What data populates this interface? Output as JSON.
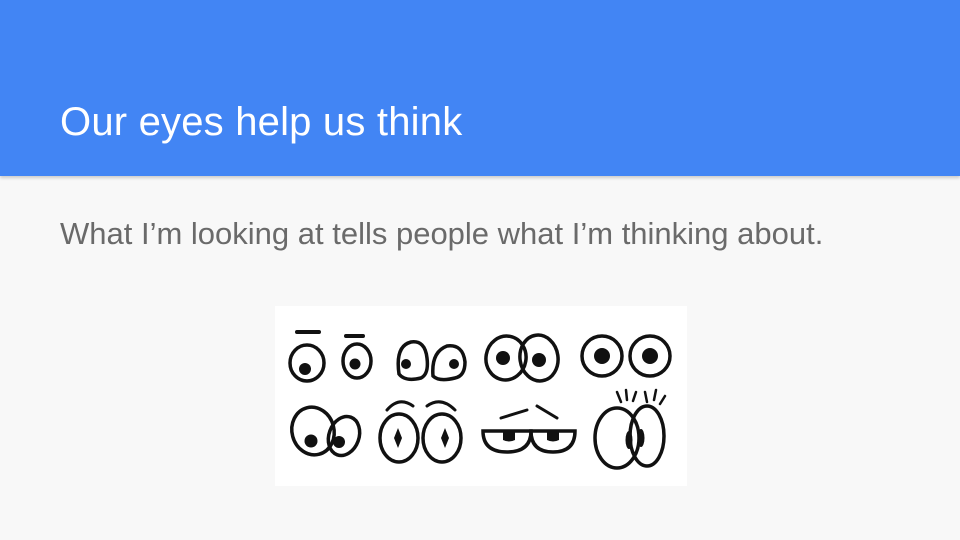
{
  "slide": {
    "title": "Our eyes help us think",
    "body": "What I’m looking at tells people what I’m thinking about."
  },
  "colors": {
    "header": "#4285f4",
    "background": "#f8f8f8",
    "title_text": "#ffffff",
    "body_text": "#6a6a6a"
  },
  "image": {
    "icon": "cartoon-eyes-illustration"
  }
}
